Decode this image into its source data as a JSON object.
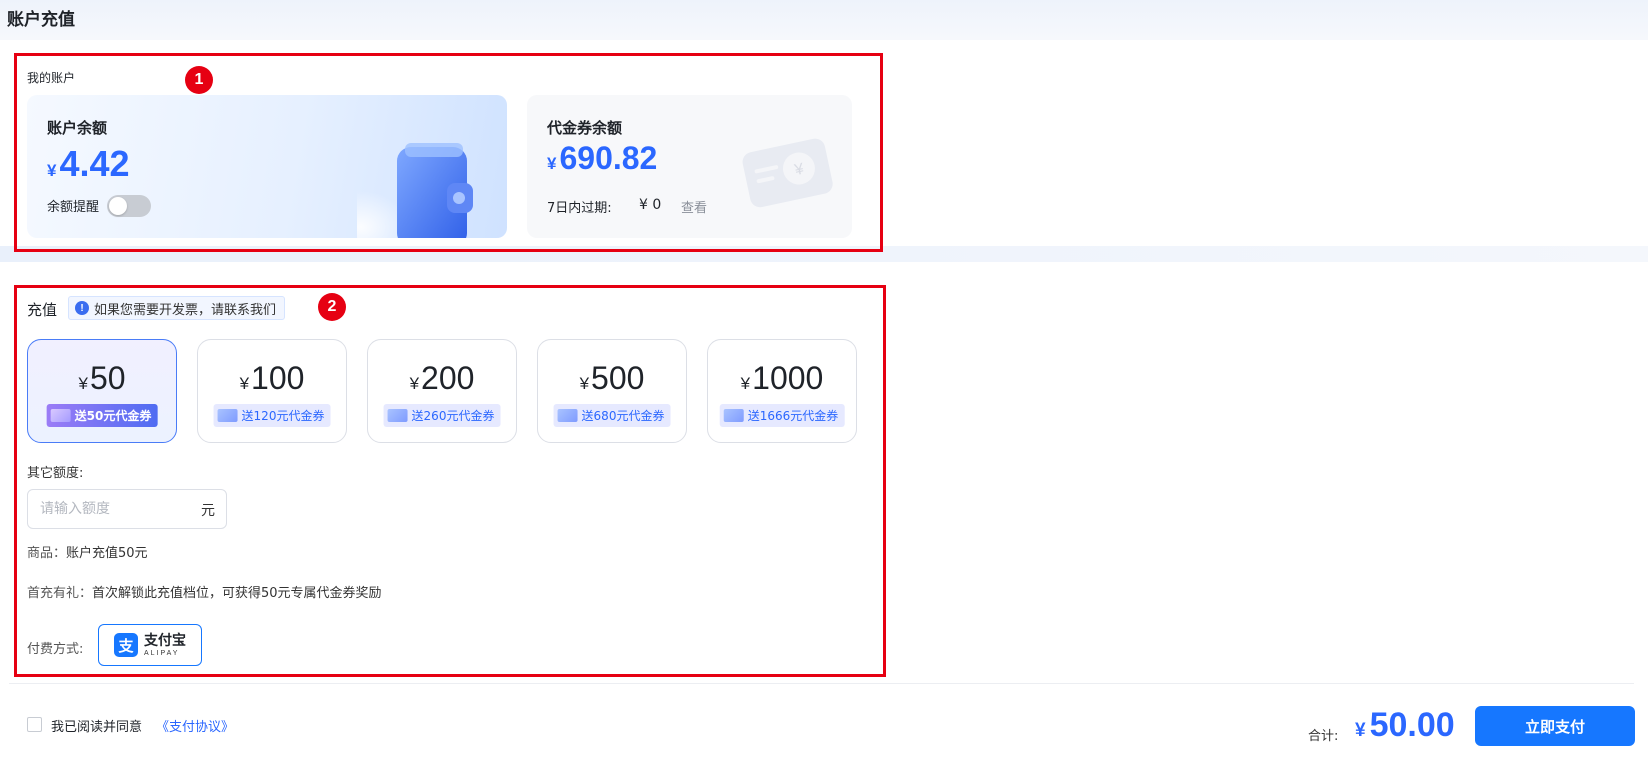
{
  "page": {
    "title": "账户充值"
  },
  "annotations": {
    "badge1": "1",
    "badge2": "2",
    "color": "#e60012"
  },
  "account": {
    "section_label": "我的账户",
    "balance": {
      "title": "账户余额",
      "currency": "¥",
      "amount": "4.42",
      "remind_label": "余额提醒",
      "remind_enabled": false
    },
    "coupon": {
      "title": "代金券余额",
      "currency": "¥",
      "amount": "690.82",
      "expire_label": "7日内过期:",
      "expire_value": "¥ 0",
      "view_link": "查看"
    }
  },
  "recharge": {
    "title": "充值",
    "invoice_tip": "如果您需要开发票，请联系我们",
    "info_icon": "!",
    "tiers": [
      {
        "currency": "¥",
        "amount": "50",
        "bonus": "送50元代金券",
        "selected": true
      },
      {
        "currency": "¥",
        "amount": "100",
        "bonus": "送120元代金券",
        "selected": false
      },
      {
        "currency": "¥",
        "amount": "200",
        "bonus": "送260元代金券",
        "selected": false
      },
      {
        "currency": "¥",
        "amount": "500",
        "bonus": "送680元代金券",
        "selected": false
      },
      {
        "currency": "¥",
        "amount": "1000",
        "bonus": "送1666元代金券",
        "selected": false
      }
    ],
    "other_label": "其它额度:",
    "input_placeholder": "请输入额度",
    "input_unit": "元",
    "product_key": "商品：",
    "product_value": "账户充值50元",
    "bonus_key": "首充有礼：",
    "bonus_value": "首次解锁此充值档位，可获得50元专属代金券奖励",
    "pay_method_label": "付费方式:",
    "alipay": {
      "logo": "支",
      "name_cn": "支付宝",
      "name_en": "ALIPAY"
    }
  },
  "footer": {
    "agree_text": "我已阅读并同意",
    "agree_link": "《支付协议》",
    "total_label": "合计:",
    "total_currency": "¥",
    "total_amount": "50.00",
    "pay_button": "立即支付"
  },
  "colors": {
    "accent": "#2b67ff",
    "primary_button": "#1677ff"
  }
}
